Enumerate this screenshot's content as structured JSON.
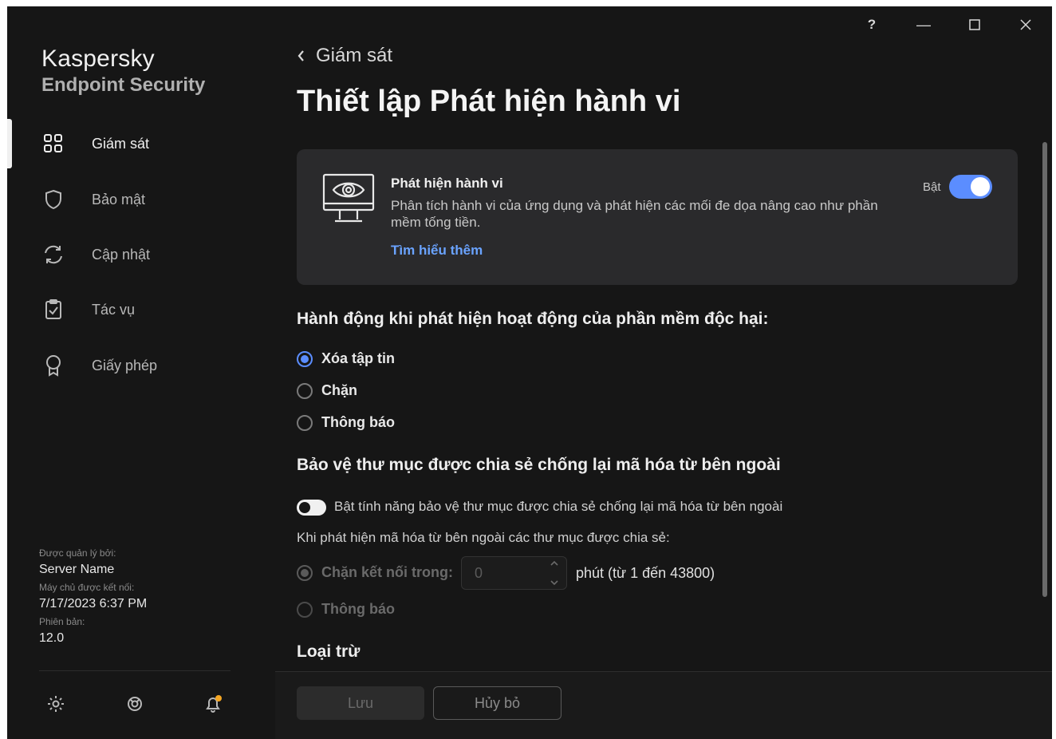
{
  "window_controls": {
    "help": "?",
    "minimize": "—",
    "maximize": "☐",
    "close": "✕"
  },
  "brand": {
    "name": "Kaspersky",
    "product": "Endpoint Security"
  },
  "sidebar": {
    "items": [
      {
        "label": "Giám sát",
        "icon": "dashboard-icon",
        "active": true
      },
      {
        "label": "Bảo mật",
        "icon": "shield-icon"
      },
      {
        "label": "Cập nhật",
        "icon": "update-icon"
      },
      {
        "label": "Tác vụ",
        "icon": "tasks-icon"
      },
      {
        "label": "Giấy phép",
        "icon": "license-icon"
      }
    ],
    "managed_by_label": "Được quản lý bởi:",
    "managed_by_value": "Server Name",
    "server_connected_label": "Máy chủ được kết nối:",
    "server_connected_value": "7/17/2023 6:37 PM",
    "version_label": "Phiên bản:",
    "version_value": "12.0",
    "bottom_icons": [
      "settings-icon",
      "support-icon",
      "notifications-icon"
    ],
    "notification_dot_color": "#f5a623"
  },
  "header": {
    "back_label": "Giám sát",
    "title": "Thiết lập Phát hiện hành vi"
  },
  "card": {
    "icon": "monitor-eye-icon",
    "title": "Phát hiện hành vi",
    "description": "Phân tích hành vi của ứng dụng và phát hiện các mối đe dọa nâng cao như phần mềm tống tiền.",
    "link": "Tìm hiểu thêm",
    "status_label": "Bật",
    "enabled": true
  },
  "actions": {
    "heading": "Hành động khi phát hiện hoạt động của phần mềm độc hại:",
    "options": [
      {
        "label": "Xóa tập tin",
        "selected": true
      },
      {
        "label": "Chặn",
        "selected": false
      },
      {
        "label": "Thông báo",
        "selected": false
      }
    ]
  },
  "shared_folders": {
    "heading": "Bảo vệ thư mục được chia sẻ chống lại mã hóa từ bên ngoài",
    "toggle_label": "Bật tính năng bảo vệ thư mục được chia sẻ chống lại mã hóa từ bên ngoài",
    "toggle_on": false,
    "subheading": "Khi phát hiện mã hóa từ bên ngoài các thư mục được chia sẻ:",
    "block_label": "Chặn kết nối trong:",
    "block_value": "0",
    "block_unit": "phút (từ 1 đến 43800)",
    "notify_label": "Thông báo"
  },
  "exclusions": {
    "heading": "Loại trừ"
  },
  "footer": {
    "save": "Lưu",
    "cancel": "Hủy bỏ"
  },
  "colors": {
    "accent": "#5b8dff",
    "link": "#6aa3ff",
    "background": "#161616",
    "card": "#2a2a2c"
  }
}
